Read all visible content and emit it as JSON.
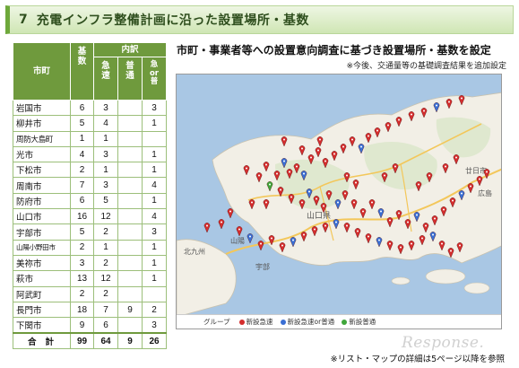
{
  "title": {
    "number": "7",
    "text": "充電インフラ整備計画に沿った設置場所・基数"
  },
  "table": {
    "headers": {
      "city": "市町",
      "total": "基数",
      "breakdown": "内訳",
      "rapid": "急速",
      "normal": "普通",
      "rapid_or_normal": "急 or 普"
    },
    "rows": [
      {
        "city": "岩国市",
        "total": "6",
        "rapid": "3",
        "normal": "",
        "either": "3"
      },
      {
        "city": "柳井市",
        "total": "5",
        "rapid": "4",
        "normal": "",
        "either": "1"
      },
      {
        "city": "周防大島町",
        "total": "1",
        "rapid": "1",
        "normal": "",
        "either": ""
      },
      {
        "city": "光市",
        "total": "4",
        "rapid": "3",
        "normal": "",
        "either": "1"
      },
      {
        "city": "下松市",
        "total": "2",
        "rapid": "1",
        "normal": "",
        "either": "1"
      },
      {
        "city": "周南市",
        "total": "7",
        "rapid": "3",
        "normal": "",
        "either": "4"
      },
      {
        "city": "防府市",
        "total": "6",
        "rapid": "5",
        "normal": "",
        "either": "1"
      },
      {
        "city": "山口市",
        "total": "16",
        "rapid": "12",
        "normal": "",
        "either": "4"
      },
      {
        "city": "宇部市",
        "total": "5",
        "rapid": "2",
        "normal": "",
        "either": "3"
      },
      {
        "city": "山陽小野田市",
        "total": "2",
        "rapid": "1",
        "normal": "",
        "either": "1"
      },
      {
        "city": "美祢市",
        "total": "3",
        "rapid": "2",
        "normal": "",
        "either": "1"
      },
      {
        "city": "萩市",
        "total": "13",
        "rapid": "12",
        "normal": "",
        "either": "1"
      },
      {
        "city": "阿武町",
        "total": "2",
        "rapid": "2",
        "normal": "",
        "either": ""
      },
      {
        "city": "長門市",
        "total": "18",
        "rapid": "7",
        "normal": "9",
        "either": "2"
      },
      {
        "city": "下関市",
        "total": "9",
        "rapid": "6",
        "normal": "",
        "either": "3"
      }
    ],
    "total_row": {
      "label": "合計",
      "total": "99",
      "rapid": "64",
      "normal": "9",
      "either": "26"
    }
  },
  "right": {
    "heading": "市町・事業者等への設置意向調査に基づき設置場所・基数を設定",
    "subnote": "※今後、交通量等の基礎調査結果を追加設定"
  },
  "map": {
    "labels": {
      "yamaguchi": "山口県",
      "kitakyushu": "北九州",
      "ube": "宇部",
      "sanyo": "山陽",
      "hatsukaichi": "廿日市",
      "hiroshima": "広島"
    },
    "legend": {
      "group": "グループ",
      "items": [
        {
          "label": "新設急速",
          "color": "#d42d2d"
        },
        {
          "label": "新設急速or普通",
          "color": "#3a6fd4"
        },
        {
          "label": "新設普通",
          "color": "#3fa63a"
        }
      ]
    }
  },
  "footnote": "※リスト・マップの詳細は5ページ以降を参照",
  "watermark": "Response."
}
